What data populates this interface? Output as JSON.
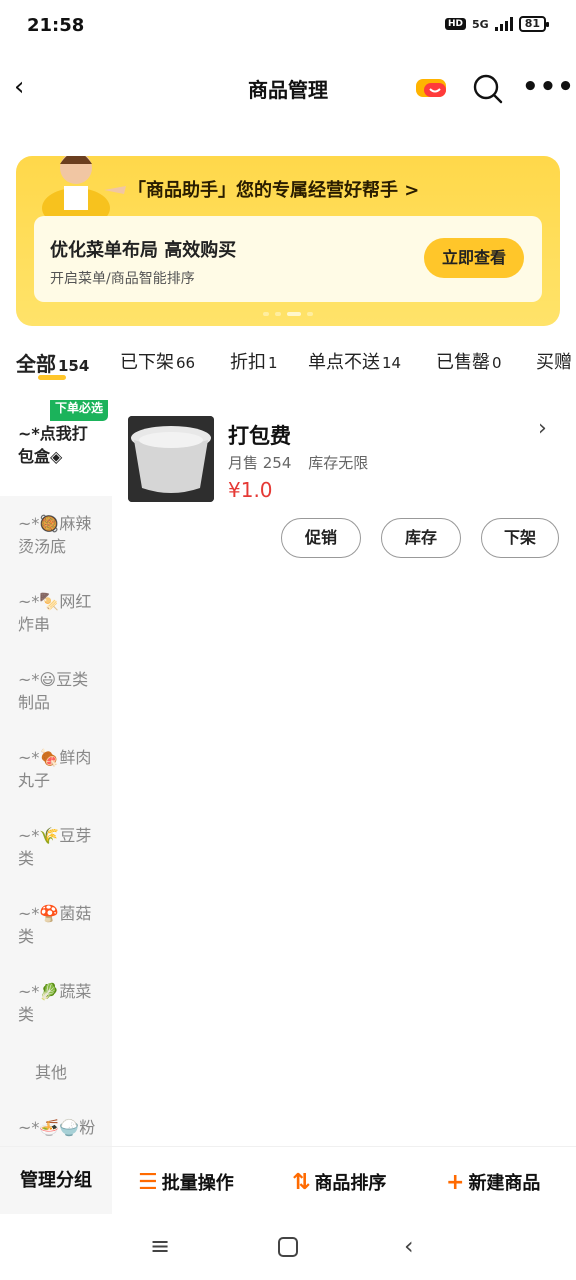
{
  "status": {
    "time": "21:58",
    "hd": "HD",
    "network": "5G",
    "battery": "81"
  },
  "navbar": {
    "title": "商品管理"
  },
  "banner": {
    "headline": "「商品助手」您的专属经营好帮手 >",
    "card_title": "优化菜单布局 高效购买",
    "card_subtitle": "开启菜单/商品智能排序",
    "card_button": "立即查看"
  },
  "tabs": [
    {
      "label": "全部",
      "count": "154"
    },
    {
      "label": "已下架",
      "count": "66"
    },
    {
      "label": "折扣",
      "count": "1"
    },
    {
      "label": "单点不送",
      "count": "14"
    },
    {
      "label": "已售罄",
      "count": "0"
    },
    {
      "label": "买赠",
      "count": ""
    }
  ],
  "sidebar": {
    "badge": "下单必选",
    "items": [
      "~*点我打包盒◈",
      "~*🥘麻辣烫汤底",
      "~*🍢网红炸串",
      "~*😃豆类制品",
      "~*🍖鲜肉丸子",
      "~*🌾豆芽类",
      "~*🍄菌菇类",
      "~*🥬蔬菜类",
      "其他",
      "~*🍜🍚粉"
    ]
  },
  "product": {
    "name": "打包费",
    "sales": "月售 254",
    "stock": "库存无限",
    "price": "¥1.0",
    "actions": [
      "促销",
      "库存",
      "下架"
    ]
  },
  "bottombar": {
    "group": "管理分组",
    "batch": "批量操作",
    "sort": "商品排序",
    "new": "新建商品"
  }
}
